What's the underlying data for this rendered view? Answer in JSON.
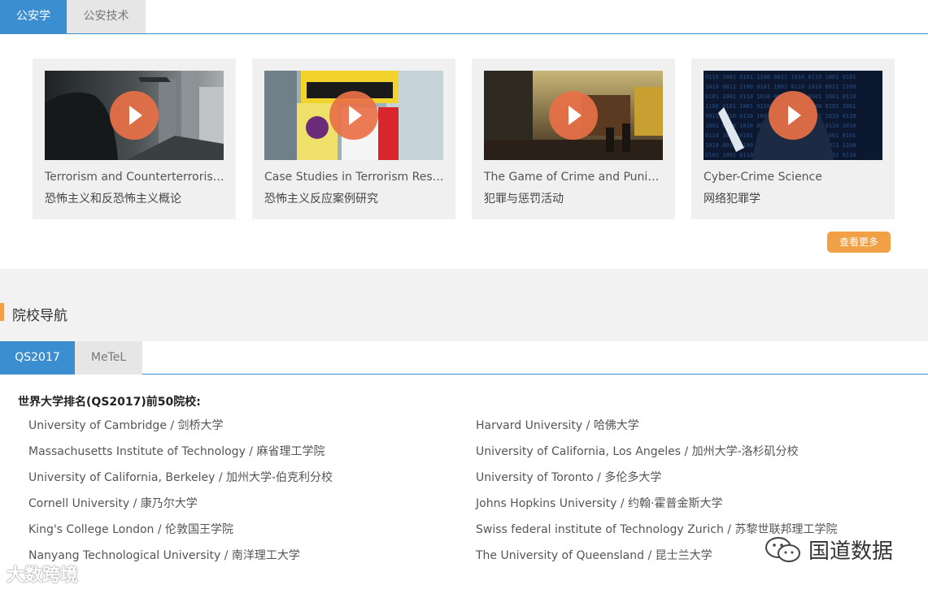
{
  "top_tabs": [
    {
      "label": "公安学",
      "active": true
    },
    {
      "label": "公安技术",
      "active": false
    }
  ],
  "courses": [
    {
      "title_en": "Terrorism and Counterterrorism: ...",
      "title_cn": "恐怖主义和反恐怖主义概论",
      "thumb": "soldier-city-scene"
    },
    {
      "title_en": "Case Studies in Terrorism Respo...",
      "title_cn": "恐怖主义反应案例研究",
      "thumb": "caution-hazard-signs"
    },
    {
      "title_en": "The Game of Crime and Punishm...",
      "title_cn": "犯罪与惩罚活动",
      "thumb": "street-market-scene"
    },
    {
      "title_en": "Cyber-Crime Science",
      "title_cn": "网络犯罪学",
      "thumb": "hooded-hacker-laptop"
    }
  ],
  "more_button": "查看更多",
  "section_title": "院校导航",
  "ranking_tabs": [
    {
      "label": "QS2017",
      "active": true
    },
    {
      "label": "MeTeL",
      "active": false
    }
  ],
  "ranking_heading": "世界大学排名(QS2017)前50院校:",
  "universities_left": [
    "University of Cambridge / 剑桥大学",
    "Massachusetts Institute of Technology / 麻省理工学院",
    "University of California, Berkeley / 加州大学-伯克利分校",
    "Cornell University / 康乃尔大学",
    "King's College London / 伦敦国王学院",
    "Nanyang Technological University / 南洋理工大学"
  ],
  "universities_right": [
    "Harvard University / 哈佛大学",
    "University of California, Los Angeles / 加州大学-洛杉矶分校",
    "University of Toronto / 多伦多大学",
    "Johns Hopkins University / 约翰·霍普金斯大学",
    "Swiss federal institute of Technology Zurich / 苏黎世联邦理工学院",
    "The University of Queensland / 昆士兰大学"
  ],
  "watermark_left": "大数跨境",
  "watermark_right": "国道数据",
  "colors": {
    "tab_active": "#3b8fd0",
    "tab_inactive": "#e6e6e6",
    "accent": "#f2a046",
    "play": "#e87046",
    "card_bg": "#f0f0f0",
    "band_bg": "#f2f2f2"
  }
}
